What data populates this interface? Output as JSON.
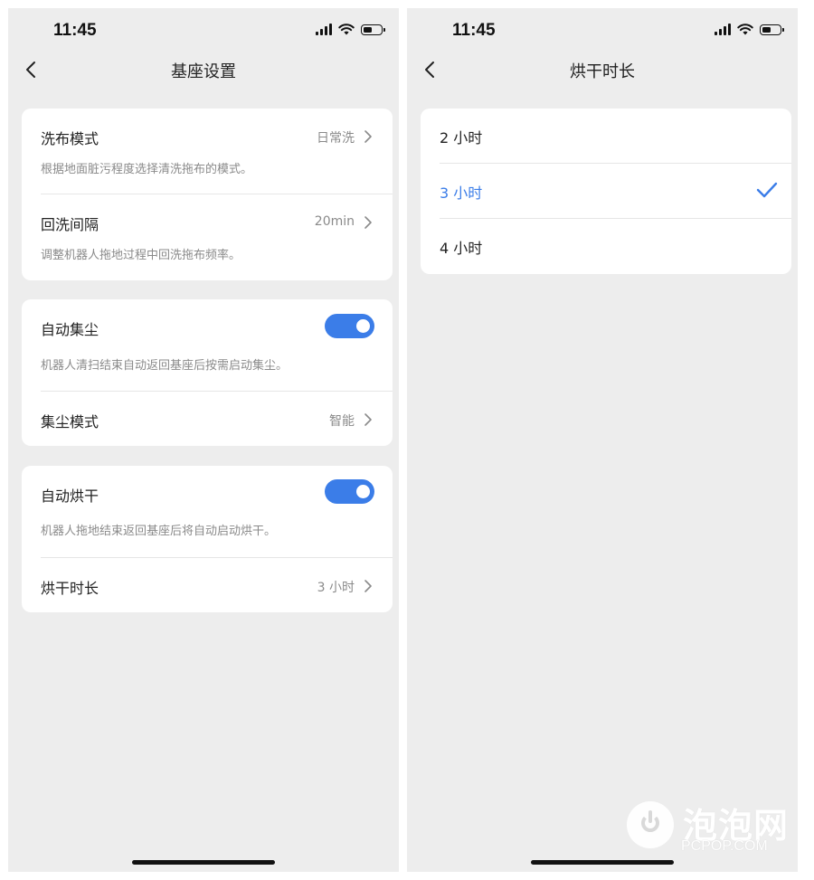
{
  "left_screen": {
    "status": {
      "time": "11:45"
    },
    "nav": {
      "title": "基座设置"
    },
    "card1": {
      "wash_mode": {
        "title": "洗布模式",
        "value": "日常洗",
        "desc": "根据地面脏污程度选择清洗拖布的模式。"
      },
      "rewash_interval": {
        "title": "回洗间隔",
        "value": "20min",
        "desc": "调整机器人拖地过程中回洗拖布频率。"
      }
    },
    "card2": {
      "auto_dust": {
        "title": "自动集尘",
        "enabled": true,
        "desc": "机器人清扫结束自动返回基座后按需启动集尘。"
      },
      "dust_mode": {
        "title": "集尘模式",
        "value": "智能"
      }
    },
    "card3": {
      "auto_dry": {
        "title": "自动烘干",
        "enabled": true,
        "desc": "机器人拖地结束返回基座后将自动启动烘干。"
      },
      "dry_duration": {
        "title": "烘干时长",
        "value": "3 小时"
      }
    }
  },
  "right_screen": {
    "status": {
      "time": "11:45"
    },
    "nav": {
      "title": "烘干时长"
    },
    "options": [
      {
        "label": "2 小时",
        "selected": false
      },
      {
        "label": "3 小时",
        "selected": true
      },
      {
        "label": "4 小时",
        "selected": false
      }
    ]
  },
  "watermark": {
    "name": "泡泡网",
    "url": "PCPOP.COM"
  },
  "colors": {
    "accent": "#3b7de8",
    "background": "#ededed",
    "card": "#ffffff",
    "text": "#222222",
    "secondary_text": "#8a8a8a"
  },
  "icons": [
    "back-chevron-icon",
    "chevron-right-icon",
    "check-icon",
    "signal-icon",
    "wifi-icon",
    "battery-icon",
    "toggle-switch"
  ]
}
